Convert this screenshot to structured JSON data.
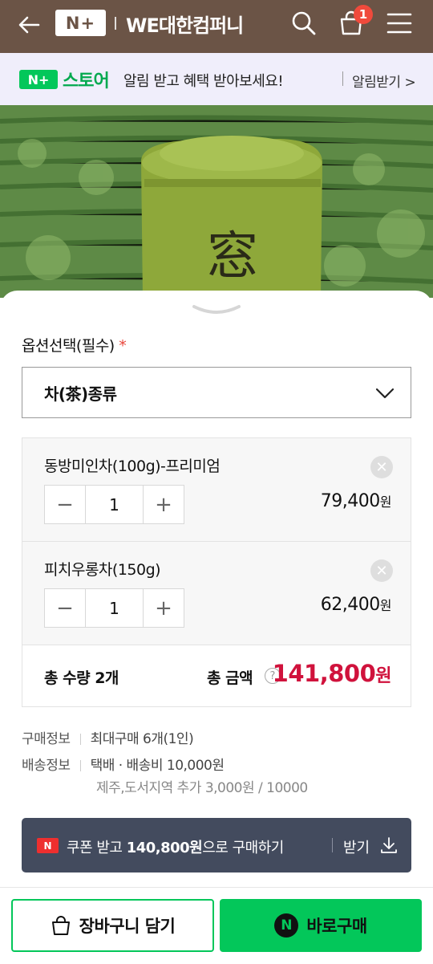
{
  "header": {
    "logo_text": "N+",
    "store_name": "WE대한컴퍼니",
    "cart_count": "1",
    "background": "#6b5446"
  },
  "banner": {
    "logo_text": "N+",
    "store_word": "스토어",
    "message": "알림 받고 혜택 받아보세요!",
    "link_label": "알림받기 >"
  },
  "options": {
    "title": "옵션선택(필수)",
    "required_mark": "*",
    "select_value": "차(茶)종류",
    "items": [
      {
        "name": "동방미인차(100g)-프리미엄",
        "qty": "1",
        "price": "79,400",
        "unit": "원"
      },
      {
        "name": "피치우롱차(150g)",
        "qty": "1",
        "price": "62,400",
        "unit": "원"
      }
    ],
    "total_qty_label": "총 수량",
    "total_qty": "2개",
    "total_amount_label": "총 금액",
    "total_amount": "141,800",
    "total_unit": "원"
  },
  "purchase_info": {
    "label": "구매정보",
    "value": "최대구매 6개(1인)"
  },
  "shipping_info": {
    "label": "배송정보",
    "value": "택배 · 배송비 10,000원",
    "sub": "제주,도서지역 추가 3,000원 / 10000"
  },
  "coupon": {
    "badge": "N",
    "text_before": "쿠폰 받고 ",
    "amount": "140,800원",
    "text_after": "으로 구매하기",
    "get_label": "받기"
  },
  "actions": {
    "cart_label": "장바구니 담기",
    "buy_label": "바로구매",
    "buy_badge": "N"
  },
  "colors": {
    "accent_green": "#03c75a",
    "price_red": "#d0123c",
    "coupon_bg": "#434b5e"
  }
}
